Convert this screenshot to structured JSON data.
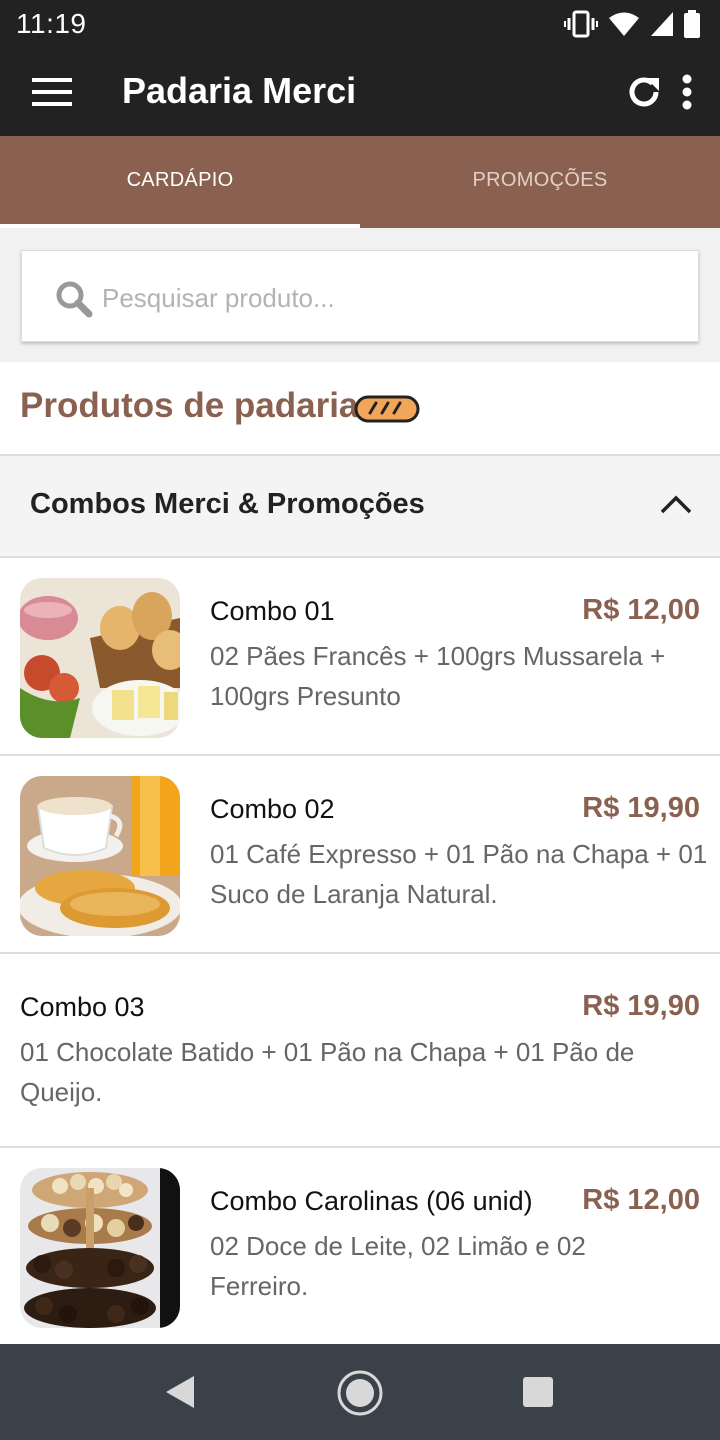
{
  "status_bar": {
    "time": "11:19"
  },
  "app_bar": {
    "title": "Padaria Merci"
  },
  "tabs": [
    {
      "label": "CARDÁPIO",
      "active": true
    },
    {
      "label": "PROMOÇÕES",
      "active": false
    }
  ],
  "search": {
    "placeholder": "Pesquisar produto...",
    "value": ""
  },
  "section": {
    "title": "Produtos de padaria",
    "icon": "bread-icon"
  },
  "category": {
    "title": "Combos Merci & Promoções",
    "expanded": true
  },
  "products": [
    {
      "name": "Combo 01",
      "price": "R$ 12,00",
      "description": "02 Pães Francês + 100grs Mussarela + 100grs Presunto",
      "image": "combo-01-photo"
    },
    {
      "name": "Combo 02",
      "price": "R$ 19,90",
      "description": "01 Café Expresso + 01 Pão na Chapa + 01 Suco de Laranja Natural.",
      "image": "combo-02-photo"
    },
    {
      "name": "Combo 03",
      "price": "R$ 19,90",
      "description": "01 Chocolate Batido + 01 Pão na Chapa + 01 Pão de Queijo.",
      "image": null
    },
    {
      "name": "Combo Carolinas (06 unid)",
      "price": "R$ 12,00",
      "description": "02 Doce de Leite, 02 Limão e 02 Ferreiro.",
      "image": "carolinas-photo"
    }
  ],
  "colors": {
    "brand": "#8a6150",
    "app_bar": "#222222",
    "nav_bar": "#3b4148"
  }
}
